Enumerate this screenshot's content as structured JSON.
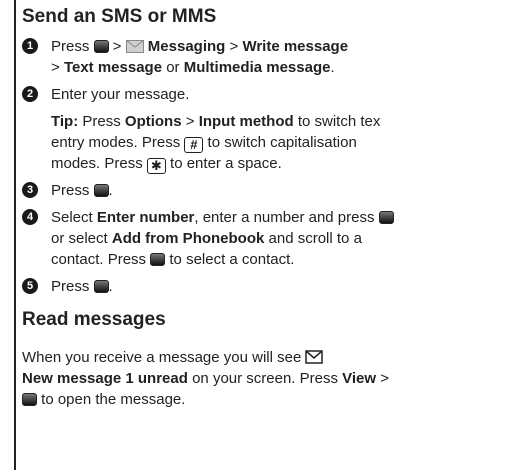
{
  "section1": {
    "heading": "Send an SMS or MMS",
    "steps": [
      {
        "num": "1",
        "press": "Press",
        "sep1": " > ",
        "messaging": "Messaging",
        "sep2": " > ",
        "write": "Write message",
        "line2_pre": "> ",
        "text_msg": "Text message",
        "or": " or ",
        "mms": "Multimedia message",
        "end": "."
      },
      {
        "num": "2",
        "text": "Enter your message."
      },
      {
        "num": "3",
        "press": "Press",
        "end": "."
      },
      {
        "num": "4",
        "select": "Select ",
        "enter_number": "Enter number",
        "mid": ", enter a number and press",
        "or_select": "or select ",
        "add_from": "Add from Phonebook",
        "scroll": " and scroll to a",
        "contact": "contact. Press",
        "to_select": " to select a contact."
      },
      {
        "num": "5",
        "press": "Press",
        "end": "."
      }
    ],
    "tip": {
      "label": "Tip:",
      "press": " Press ",
      "options": "Options",
      "sep": " > ",
      "input_method": "Input method",
      "switch_text": " to switch tex",
      "entry": "entry modes. Press",
      "switch_cap": " to switch capitalisation",
      "modes": "modes. Press",
      "space": " to enter a space.",
      "key_hash": "#",
      "key_star": "✱"
    }
  },
  "section2": {
    "heading": "Read messages",
    "line1": "When you receive a message you will see",
    "new_msg": "New message 1 unread",
    "on_screen": " on your screen. Press ",
    "view": "View",
    "gt": " >",
    "open": " to open the message."
  }
}
